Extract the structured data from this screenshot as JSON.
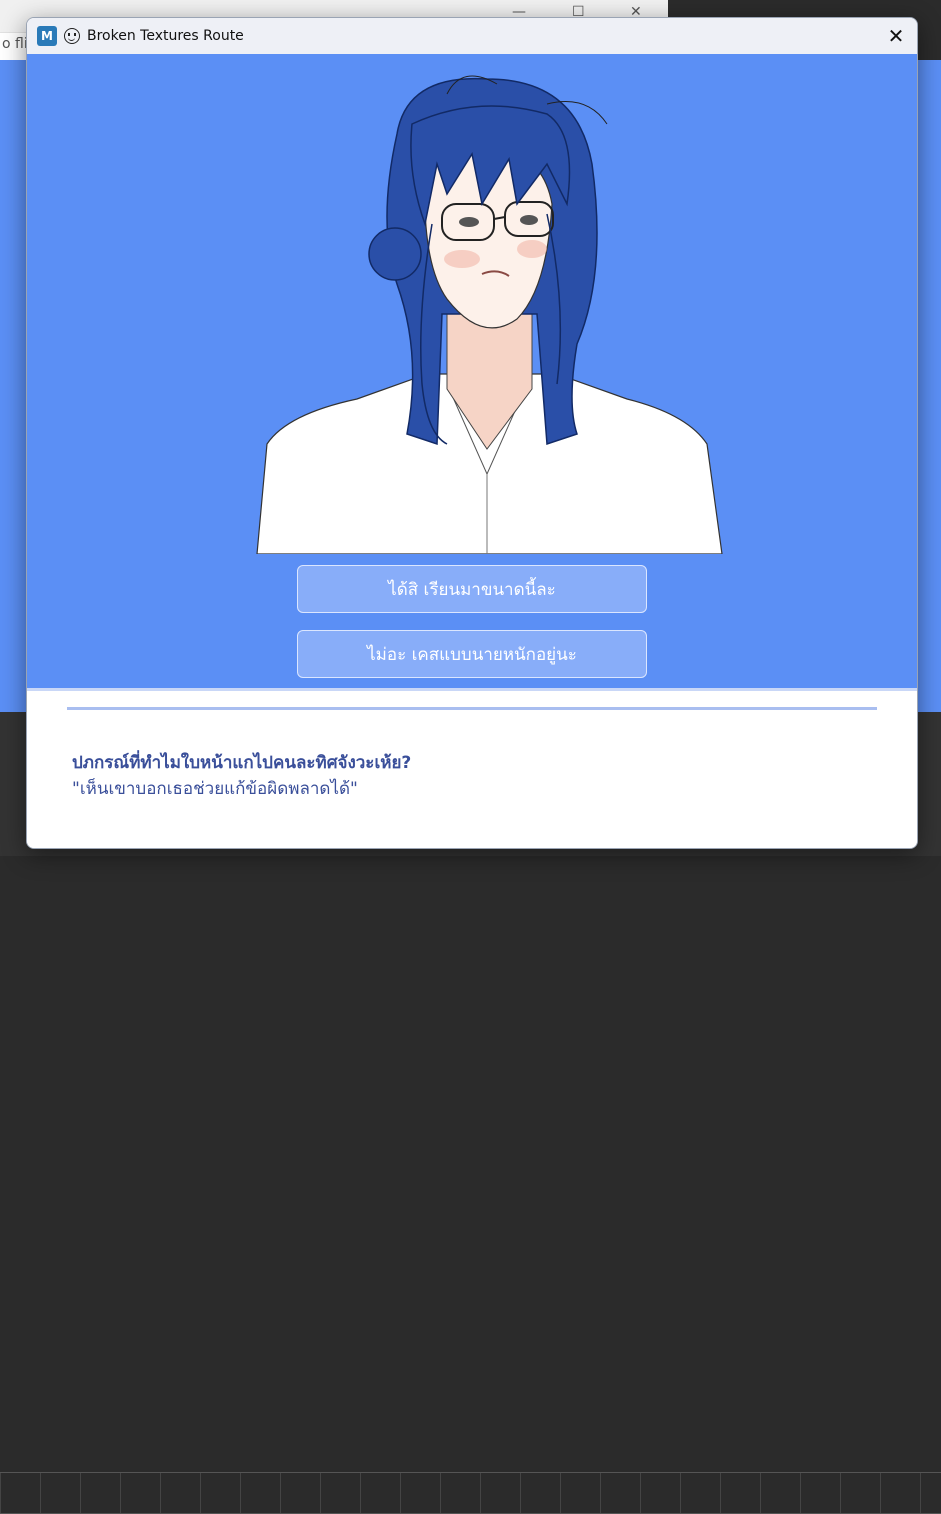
{
  "background": {
    "address_text": "o flir"
  },
  "window": {
    "title": "Broken Textures Route",
    "app_icon_letter": "M",
    "close_glyph": "✕"
  },
  "choices": [
    {
      "label": "ได้สิ เรียนมาขนาดนี้ละ"
    },
    {
      "label": "ไม่อะ เคสแบบนายหนักอยู่นะ"
    }
  ],
  "textbox": {
    "speaker": "ปภกรณ์ที่ทำไมใบหน้าแกไปคนละทิศจังวะเห้ย?",
    "line": "\"เห็นเขาบอกเธอช่วยแก้ข้อผิดพลาดได้\""
  },
  "colors": {
    "stage_bg": "#5b8ff5",
    "text_accent": "#3a4f9a",
    "hair": "#2a4fa8"
  }
}
